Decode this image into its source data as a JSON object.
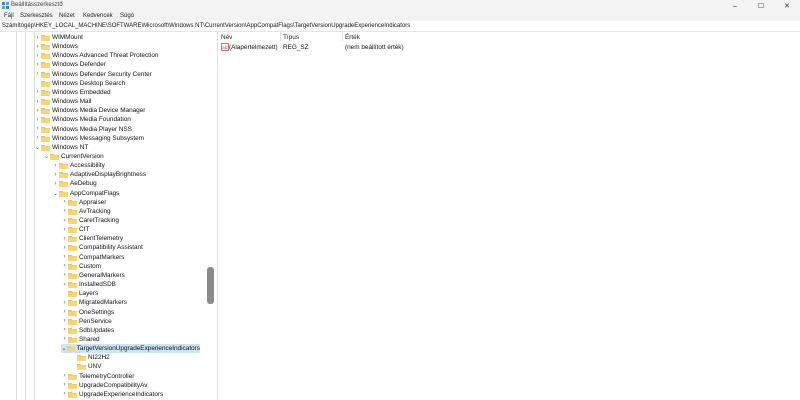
{
  "window": {
    "title": "Beállításszerkesztő",
    "controls": {
      "minimize": "–",
      "maximize": "☐",
      "close": "✕"
    }
  },
  "menu": [
    "Fájl",
    "Szerkesztés",
    "Nézet",
    "Kedvencek",
    "Súgó"
  ],
  "address": "Számítógép\\HKEY_LOCAL_MACHINE\\SOFTWARE\\Microsoft\\Windows NT\\CurrentVersion\\AppCompatFlags\\TargetVersionUpgradeExperienceIndicators",
  "tree": [
    {
      "label": "WIMMount",
      "level": 0,
      "expander": "closed"
    },
    {
      "label": "Windows",
      "level": 0,
      "expander": "closed"
    },
    {
      "label": "Windows Advanced Threat Protection",
      "level": 0,
      "expander": "closed"
    },
    {
      "label": "Windows Defender",
      "level": 0,
      "expander": "closed"
    },
    {
      "label": "Windows Defender Security Center",
      "level": 0,
      "expander": "closed"
    },
    {
      "label": "Windows Desktop Search",
      "level": 0,
      "expander": "none"
    },
    {
      "label": "Windows Embedded",
      "level": 0,
      "expander": "closed"
    },
    {
      "label": "Windows Mail",
      "level": 0,
      "expander": "closed"
    },
    {
      "label": "Windows Media Device Manager",
      "level": 0,
      "expander": "closed"
    },
    {
      "label": "Windows Media Foundation",
      "level": 0,
      "expander": "closed"
    },
    {
      "label": "Windows Media Player NSS",
      "level": 0,
      "expander": "closed"
    },
    {
      "label": "Windows Messaging Subsystem",
      "level": 0,
      "expander": "closed"
    },
    {
      "label": "Windows NT",
      "level": 0,
      "expander": "open"
    },
    {
      "label": "CurrentVersion",
      "level": 1,
      "expander": "open"
    },
    {
      "label": "Accessibility",
      "level": 2,
      "expander": "closed"
    },
    {
      "label": "AdaptiveDisplayBrightness",
      "level": 2,
      "expander": "closed"
    },
    {
      "label": "AeDebug",
      "level": 2,
      "expander": "closed"
    },
    {
      "label": "AppCompatFlags",
      "level": 2,
      "expander": "open"
    },
    {
      "label": "Appraiser",
      "level": 3,
      "expander": "closed"
    },
    {
      "label": "AvTracking",
      "level": 3,
      "expander": "closed"
    },
    {
      "label": "CaretTracking",
      "level": 3,
      "expander": "closed"
    },
    {
      "label": "CIT",
      "level": 3,
      "expander": "closed"
    },
    {
      "label": "ClientTelemetry",
      "level": 3,
      "expander": "closed"
    },
    {
      "label": "Compatibility Assistant",
      "level": 3,
      "expander": "closed"
    },
    {
      "label": "CompatMarkers",
      "level": 3,
      "expander": "closed"
    },
    {
      "label": "Custom",
      "level": 3,
      "expander": "closed"
    },
    {
      "label": "GeneralMarkers",
      "level": 3,
      "expander": "closed"
    },
    {
      "label": "InstalledSDB",
      "level": 3,
      "expander": "closed"
    },
    {
      "label": "Layers",
      "level": 3,
      "expander": "none"
    },
    {
      "label": "MigratedMarkers",
      "level": 3,
      "expander": "closed"
    },
    {
      "label": "OneSettings",
      "level": 3,
      "expander": "closed"
    },
    {
      "label": "PenService",
      "level": 3,
      "expander": "closed"
    },
    {
      "label": "SdbUpdates",
      "level": 3,
      "expander": "closed"
    },
    {
      "label": "Shared",
      "level": 3,
      "expander": "closed"
    },
    {
      "label": "TargetVersionUpgradeExperienceIndicators",
      "level": 3,
      "expander": "open",
      "selected": true
    },
    {
      "label": "NI22H2",
      "level": 4,
      "expander": "none"
    },
    {
      "label": "UNV",
      "level": 4,
      "expander": "none"
    },
    {
      "label": "TelemetryController",
      "level": 3,
      "expander": "closed"
    },
    {
      "label": "UpgradeCompatibilityAv",
      "level": 3,
      "expander": "closed"
    },
    {
      "label": "UpgradeExperienceIndicators",
      "level": 3,
      "expander": "closed"
    }
  ],
  "columns": {
    "name": "Név",
    "type": "Típus",
    "value": "Érték"
  },
  "values": [
    {
      "name": "(Alapértelmezett)",
      "type": "REG_SZ",
      "data": "(nem beállított érték)",
      "icon": "string-value-icon"
    }
  ],
  "colors": {
    "folder": "#f2c14e",
    "selection": "#cce4f7",
    "chrome": "#f3f3f3"
  }
}
